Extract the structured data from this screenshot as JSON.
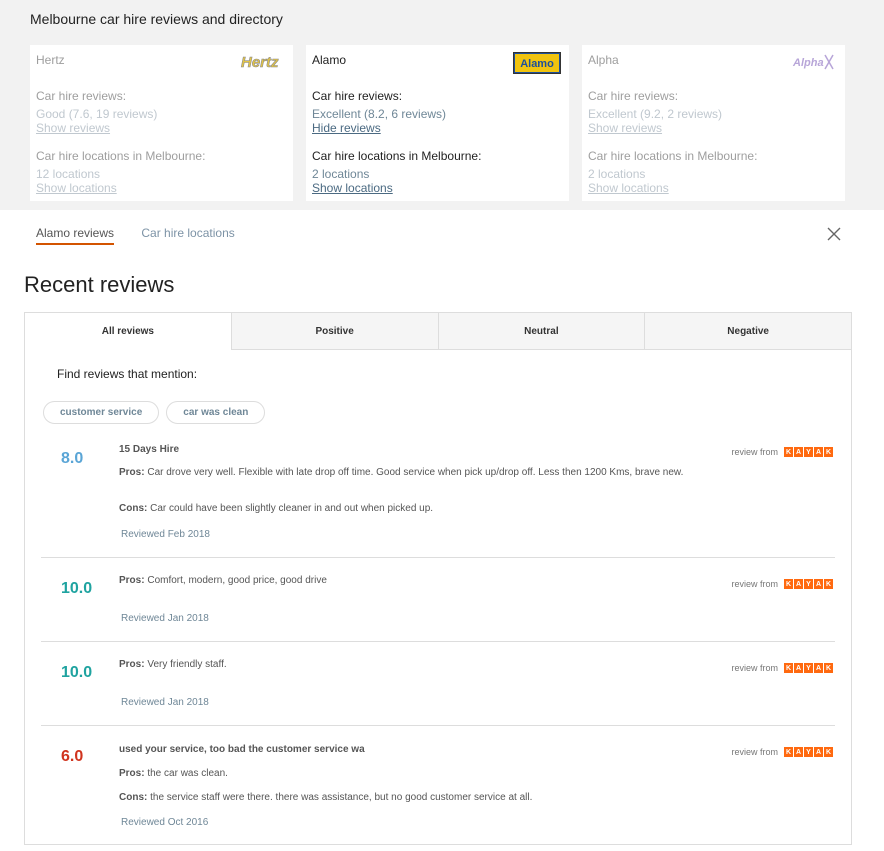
{
  "page": {
    "title": "Melbourne car hire reviews and directory"
  },
  "companies": [
    {
      "name": "Hertz",
      "logo_text": "Hertz",
      "reviews_label": "Car hire reviews:",
      "rating": "Good (7.6, 19 reviews)",
      "reviews_link": "Show reviews",
      "locations_label": "Car hire locations in Melbourne:",
      "locations_count": "12 locations",
      "locations_link": "Show locations"
    },
    {
      "name": "Alamo",
      "logo_text": "Alamo",
      "reviews_label": "Car hire reviews:",
      "rating": "Excellent (8.2, 6 reviews)",
      "reviews_link": "Hide reviews",
      "locations_label": "Car hire locations in Melbourne:",
      "locations_count": "2 locations",
      "locations_link": "Show locations"
    },
    {
      "name": "Alpha",
      "logo_text": "Alpha",
      "reviews_label": "Car hire reviews:",
      "rating": "Excellent (9.2, 2 reviews)",
      "reviews_link": "Show reviews",
      "locations_label": "Car hire locations in Melbourne:",
      "locations_count": "2 locations",
      "locations_link": "Show locations"
    }
  ],
  "detail_tabs": {
    "active": "Alamo reviews",
    "inactive": "Car hire locations"
  },
  "recent_heading": "Recent reviews",
  "filter_tabs": [
    "All reviews",
    "Positive",
    "Neutral",
    "Negative"
  ],
  "mention": {
    "label": "Find reviews that mention:",
    "chips": [
      "customer service",
      "car was clean"
    ]
  },
  "review_from_label": "review from",
  "kayak_letters": [
    "K",
    "A",
    "Y",
    "A",
    "K"
  ],
  "reviews": [
    {
      "score": "8.0",
      "score_color": "#5aa5d6",
      "title": "15 Days Hire",
      "pros_label": "Pros:",
      "pros": "Car drove very well. Flexible with late drop off time. Good service when pick up/drop off. Less then 1200 Kms, brave new.",
      "cons_label": "Cons:",
      "cons": "Car could have been slightly cleaner in and out when picked up.",
      "date": "Reviewed Feb 2018"
    },
    {
      "score": "10.0",
      "score_color": "#1fa3a0",
      "title": "",
      "pros_label": "Pros:",
      "pros": "Comfort, modern, good price, good drive",
      "cons_label": "",
      "cons": "",
      "date": "Reviewed Jan 2018"
    },
    {
      "score": "10.0",
      "score_color": "#1fa3a0",
      "title": "",
      "pros_label": "Pros:",
      "pros": "Very friendly staff.",
      "cons_label": "",
      "cons": "",
      "date": "Reviewed Jan 2018"
    },
    {
      "score": "6.0",
      "score_color": "#d0341e",
      "title": "used your service, too bad the customer service wa",
      "pros_label": "Pros:",
      "pros": "the car was clean.",
      "cons_label": "Cons:",
      "cons": "the service staff were there. there was assistance, but no good customer service at all.",
      "date": "Reviewed Oct 2016"
    }
  ],
  "colors": {
    "accent_underline": "#d35400",
    "kayak_orange": "#ff690f",
    "link_blue": "#4b6a82"
  }
}
